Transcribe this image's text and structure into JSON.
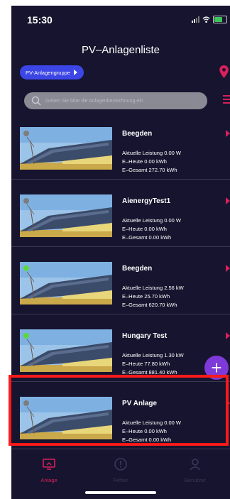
{
  "status": {
    "time": "15:30"
  },
  "header": {
    "title": "PV–Anlagenliste"
  },
  "group_button": {
    "label": "PV-Anlagengruppe"
  },
  "search": {
    "placeholder": "Geben Sie bitte die Anlagenbezeichnung ein"
  },
  "plants": [
    {
      "name": "Beegden",
      "status": "gray",
      "power": "Aktuelle Leistung 0.00 W",
      "today": "E–Heute 0.00 kWh",
      "total": "E–Gesamt 272.70 kWh"
    },
    {
      "name": "AienergyTest1",
      "status": "gray",
      "power": "Aktuelle Leistung 0.00 W",
      "today": "E–Heute 0.00 kWh",
      "total": "E–Gesamt 0.00 kWh"
    },
    {
      "name": "Beegden",
      "status": "green",
      "power": "Aktuelle Leistung 2.56 kW",
      "today": "E–Heute 25.70 kWh",
      "total": "E–Gesamt 620.70 kWh"
    },
    {
      "name": "Hungary Test",
      "status": "green",
      "power": "Aktuelle Leistung 1.30 kW",
      "today": "E–Heute 77.80 kWh",
      "total": "E–Gesamt 881.40 kWh"
    },
    {
      "name": "PV Anlage",
      "status": "gray",
      "power": "Aktuelle Leistung 0.00 W",
      "today": "E–Heute 0.00 kWh",
      "total": "E–Gesamt 0.00 kWh"
    }
  ],
  "fab": {
    "label": "+"
  },
  "tabs": [
    {
      "label": "Anlage",
      "icon": "monitor-icon",
      "active": true
    },
    {
      "label": "Fehler",
      "icon": "error-icon",
      "active": false
    },
    {
      "label": "Benutzer",
      "icon": "user-icon",
      "active": false
    }
  ],
  "colors": {
    "background": "#16142e",
    "accent": "#d8205c",
    "button": "#3c46e6",
    "fab": "#7d3ad8",
    "highlight": "#ff1a1a"
  }
}
